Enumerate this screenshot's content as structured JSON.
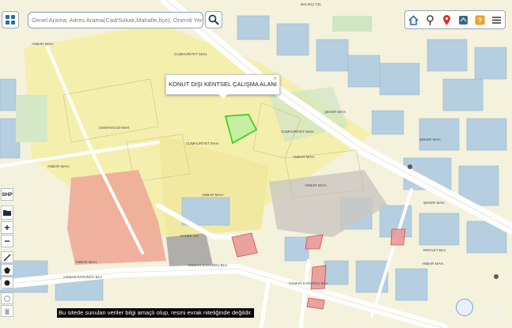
{
  "search": {
    "placeholder": "Genel Arama; Adres Arama(Cad/Sokak,Mahalle,İlçe), Önemli Yer Aran"
  },
  "toolbar": {
    "icons": [
      "home-icon",
      "route-icon",
      "location-icon",
      "layers-icon",
      "help-icon",
      "menu-icon"
    ]
  },
  "popup": {
    "text": "KONUT DIŞI KENTSEL ÇALIŞMA ALANI",
    "close": "×"
  },
  "left_controls": {
    "shp": "SHP",
    "zoom_in": "+",
    "zoom_out": "−"
  },
  "map_labels": [
    "CUMHURİYET MAH.",
    "ANBAR MAH.",
    "OSMANGAZİ MAH.",
    "CUMHURİYET MAH.",
    "CUMHURİYET MAH.",
    "ANBAR MAH.",
    "ANBAR MAH.",
    "ŞEKER MAH.",
    "ANBAR MAH.",
    "ANBAR MAH.",
    "ŞEKER MAH.",
    "ŞEKER MAH.",
    "ANBAR MAH.",
    "OSMAN KAVUNCU BLV.",
    "OSMAN KAVUNCU BLV.",
    "OSMAN KAVUNCU BLV.",
    "ZAFER CD.",
    "ERKİLET BLV.",
    "ANBAR MAH.",
    "BALIKÇI CD."
  ],
  "disclaimer": "Bu sitede sunulan veriler bilgi amaçlı olup, resmi evrak niteliğinde değildir.",
  "brand": "EBS",
  "colors": {
    "highlight": "#c6f0a0",
    "highlight_stroke": "#3cd12a",
    "parcel_red": "#e89a9a",
    "basemap": "#f3efd6"
  }
}
